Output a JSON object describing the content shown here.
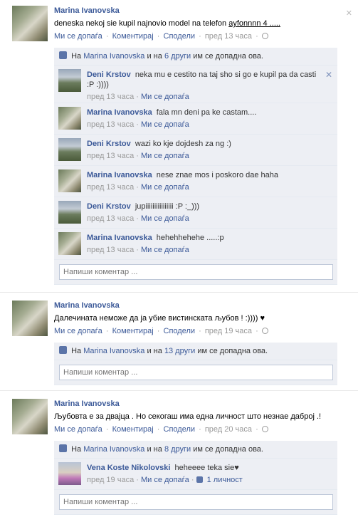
{
  "labels": {
    "like": "Ми се допаѓа",
    "comment": "Коментирај",
    "share": "Сподели",
    "dot": "·",
    "likes_prefix": "На",
    "likes_and": "и на",
    "likes_suffix": "им се допадна ова.",
    "comment_placeholder": "Напиши коментар ...",
    "close": "✕"
  },
  "posts": [
    {
      "author": "Marina Ivanovska",
      "message_before": "deneska nekoj sie kupil najnovio model na telefon ",
      "message_link": "ayfonnnn 4 .....",
      "time": "пред 13 часа",
      "likes_name": "Marina Ivanovska",
      "likes_others": "6 други",
      "comments": [
        {
          "author": "Deni Krstov",
          "text": "neka mu e cestito na taj sho si go e kupil pa da casti :P :))))",
          "time": "пред 13 часа",
          "like": "Ми се допаѓа"
        },
        {
          "author": "Marina Ivanovska",
          "text": "fala mn deni pa ke castam....",
          "time": "пред 13 часа",
          "like": "Ми се допаѓа"
        },
        {
          "author": "Deni Krstov",
          "text": "wazi ko kje dojdesh za ng :)",
          "time": "пред 13 часа",
          "like": "Ми се допаѓа"
        },
        {
          "author": "Marina Ivanovska",
          "text": "nese znae mos i poskoro dae haha",
          "time": "пред 13 часа",
          "like": "Ми се допаѓа"
        },
        {
          "author": "Deni Krstov",
          "text": "jupiiiiiiiiiiiiiiii :P :_)))",
          "time": "пред 13 часа",
          "like": "Ми се допаѓа"
        },
        {
          "author": "Marina Ivanovska",
          "text": "hehehhehehe .....:p",
          "time": "пред 13 часа",
          "like": "Ми се допаѓа"
        }
      ]
    },
    {
      "author": "Marina Ivanovska",
      "message": "Далечината неможе да ја убие вистинската љубов ! :)))) ♥",
      "time": "пред 19 часа",
      "likes_name": "Marina Ivanovska",
      "likes_others": "13 други"
    },
    {
      "author": "Marina Ivanovska",
      "message": "Љубовта е за двајца . Но секогаш има една личност што незнае даброј .!",
      "time": "пред 20 часа",
      "likes_name": "Marina Ivanovska",
      "likes_others": "8 други",
      "comments": [
        {
          "author": "Vena Koste Nikolovski",
          "text": "heheeee teka sie♥",
          "time": "пред 19 часа",
          "like": "Ми се допаѓа",
          "like_count": "1 личност"
        }
      ]
    }
  ]
}
